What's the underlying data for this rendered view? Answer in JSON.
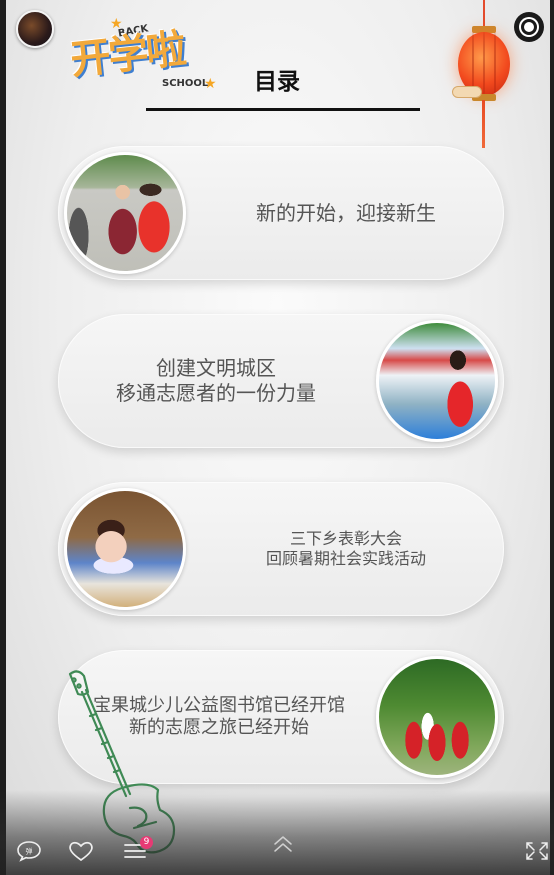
{
  "header": {
    "logo": {
      "main": "开学啦",
      "back": "BACK",
      "school": "SCHOOL"
    },
    "title": "目录"
  },
  "menu_items": [
    {
      "lines": [
        "新的开始，迎接新生"
      ],
      "photo_side": "left"
    },
    {
      "lines": [
        "创建文明城区",
        "移通志愿者的一份力量"
      ],
      "photo_side": "right"
    },
    {
      "lines": [
        "三下乡表彰大会",
        "回顾暑期社会实践活动"
      ],
      "photo_side": "left"
    },
    {
      "lines": [
        "宝果城少儿公益图书馆已经开馆",
        "新的志愿之旅已经开始"
      ],
      "photo_side": "right"
    }
  ],
  "bottom_bar": {
    "badge_count": "9",
    "icons": [
      "comment-icon",
      "heart-icon",
      "menu-icon",
      "chevron-up-icon",
      "fullscreen-icon"
    ]
  },
  "colors": {
    "text": "#555555",
    "title": "#111111",
    "badge": "#e73a74",
    "lantern": "#f24a1e"
  }
}
